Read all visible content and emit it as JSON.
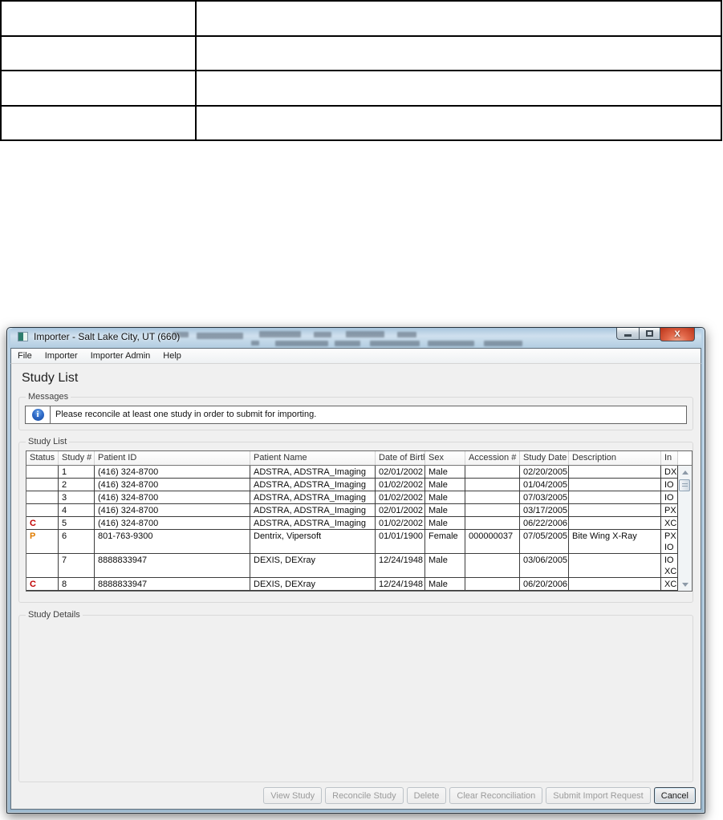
{
  "document": {
    "top_table": {
      "row_count": 4,
      "col_count": 2,
      "cells": [
        "",
        "",
        "",
        "",
        "",
        "",
        "",
        ""
      ]
    }
  },
  "window": {
    "title": "Importer - Salt Lake City, UT (660)",
    "controls": {
      "minimize": "minimize",
      "maximize": "maximize",
      "close": "x"
    },
    "menu_items": [
      "File",
      "Importer",
      "Importer Admin",
      "Help"
    ],
    "page_title": "Study List",
    "messages": {
      "group_label": "Messages",
      "info_text": "Please reconcile at least one study in order to submit for importing."
    },
    "study_list": {
      "group_label": "Study List",
      "columns": [
        "Status",
        "Study #",
        "Patient ID",
        "Patient Name",
        "Date of Birth",
        "Sex",
        "Accession #",
        "Study Date",
        "Description",
        "In"
      ],
      "status_colors": {
        "C": "#c00000",
        "P": "#e07c00"
      },
      "rows": [
        {
          "status": "",
          "study_num": "1",
          "patient_id": "(416) 324-8700",
          "patient_name": "ADSTRA, ADSTRA_Imaging",
          "dob": "02/01/2002",
          "sex": "Male",
          "accession": "",
          "study_date": "02/20/2005",
          "description": "",
          "in": [
            "DX"
          ]
        },
        {
          "status": "",
          "study_num": "2",
          "patient_id": "(416) 324-8700",
          "patient_name": "ADSTRA, ADSTRA_Imaging",
          "dob": "01/02/2002",
          "sex": "Male",
          "accession": "",
          "study_date": "01/04/2005",
          "description": "",
          "in": [
            "IO"
          ]
        },
        {
          "status": "",
          "study_num": "3",
          "patient_id": "(416) 324-8700",
          "patient_name": "ADSTRA, ADSTRA_Imaging",
          "dob": "01/02/2002",
          "sex": "Male",
          "accession": "",
          "study_date": "07/03/2005",
          "description": "",
          "in": [
            "IO"
          ]
        },
        {
          "status": "",
          "study_num": "4",
          "patient_id": "(416) 324-8700",
          "patient_name": "ADSTRA, ADSTRA_Imaging",
          "dob": "02/01/2002",
          "sex": "Male",
          "accession": "",
          "study_date": "03/17/2005",
          "description": "",
          "in": [
            "PX"
          ]
        },
        {
          "status": "C",
          "study_num": "5",
          "patient_id": "(416) 324-8700",
          "patient_name": "ADSTRA, ADSTRA_Imaging",
          "dob": "01/02/2002",
          "sex": "Male",
          "accession": "",
          "study_date": "06/22/2006",
          "description": "",
          "in": [
            "XC"
          ]
        },
        {
          "status": "P",
          "study_num": "6",
          "patient_id": "801-763-9300",
          "patient_name": "Dentrix, Vipersoft",
          "dob": "01/01/1900",
          "sex": "Female",
          "accession": "000000037",
          "study_date": "07/05/2005",
          "description": "Bite Wing X-Ray",
          "in": [
            "PX",
            "IO"
          ]
        },
        {
          "status": "",
          "study_num": "7",
          "patient_id": "8888833947",
          "patient_name": "DEXIS, DEXray",
          "dob": "12/24/1948",
          "sex": "Male",
          "accession": "",
          "study_date": "03/06/2005",
          "description": "",
          "in": [
            "IO",
            "XC"
          ]
        },
        {
          "status": "C",
          "study_num": "8",
          "patient_id": "8888833947",
          "patient_name": "DEXIS, DEXray",
          "dob": "12/24/1948",
          "sex": "Male",
          "accession": "",
          "study_date": "06/20/2006",
          "description": "",
          "in": [
            "XC"
          ]
        }
      ]
    },
    "study_details": {
      "group_label": "Study Details"
    },
    "footer_buttons": [
      {
        "label": "View Study",
        "enabled": false
      },
      {
        "label": "Reconcile Study",
        "enabled": false
      },
      {
        "label": "Delete",
        "enabled": false
      },
      {
        "label": "Clear Reconciliation",
        "enabled": false
      },
      {
        "label": "Submit Import Request",
        "enabled": false
      },
      {
        "label": "Cancel",
        "enabled": true
      }
    ]
  }
}
